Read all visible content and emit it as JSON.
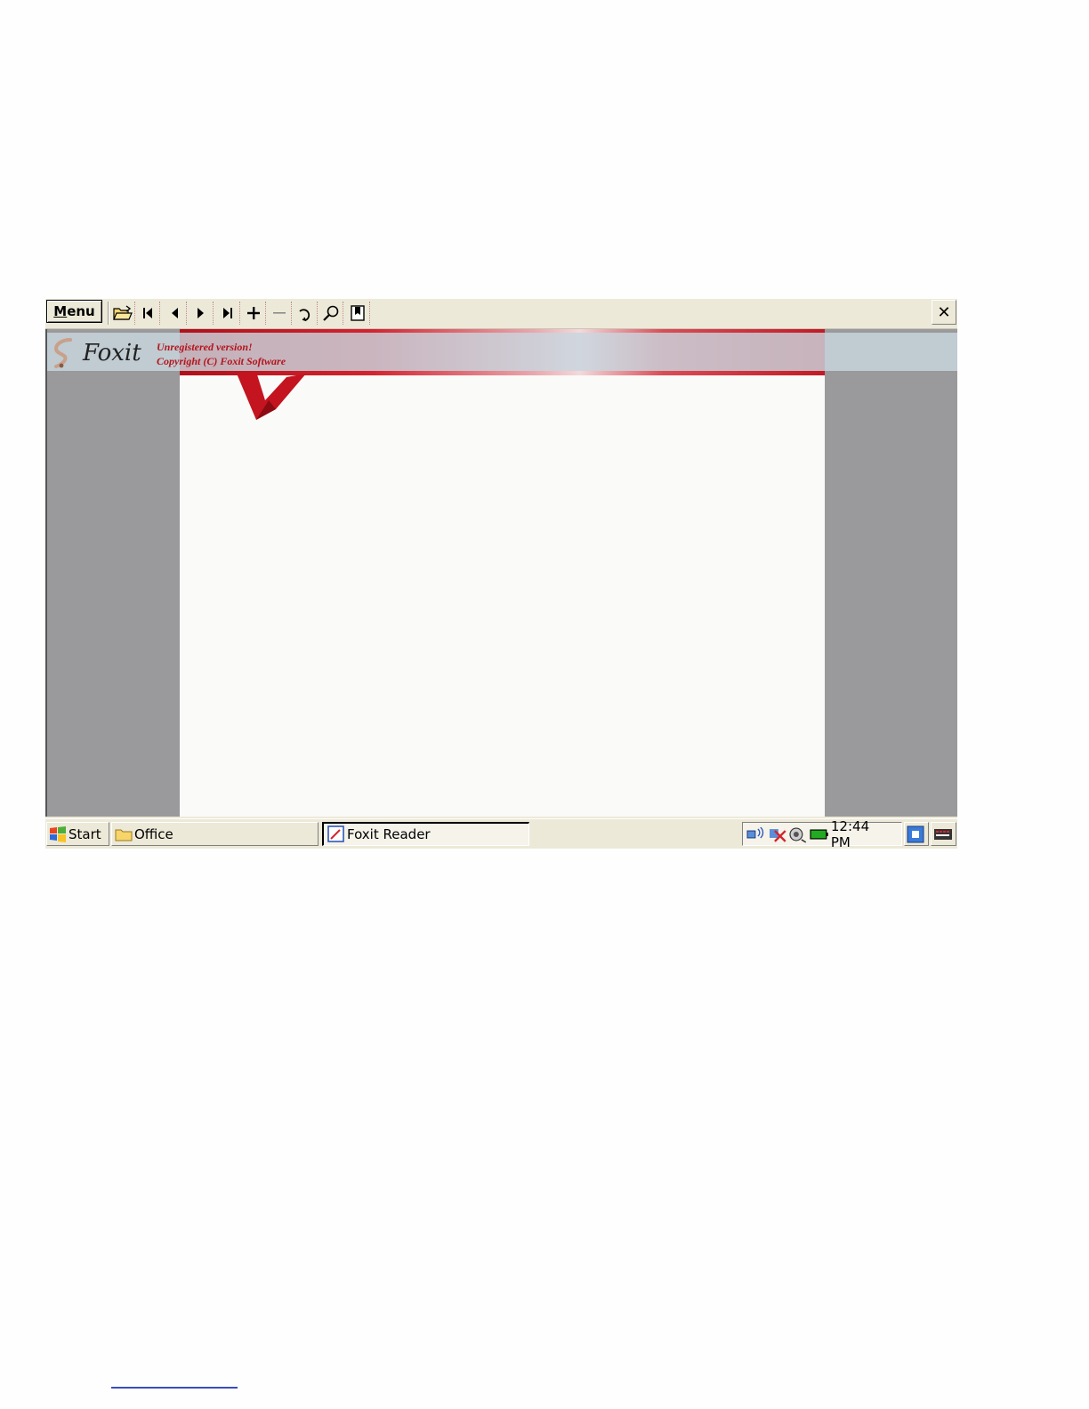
{
  "toolbar": {
    "menu_label_underlined": "M",
    "menu_label_rest": "enu",
    "buttons": [
      "open-icon",
      "first-page-icon",
      "previous-page-icon",
      "next-page-icon",
      "last-page-icon",
      "zoom-in-icon",
      "zoom-out-icon",
      "rotate-icon",
      "find-icon",
      "bookmark-icon"
    ],
    "close_glyph": "✕"
  },
  "banner": {
    "app_name": "Foxit",
    "line1": "Unregistered version!",
    "line2": "Copyright (C) Foxit Software"
  },
  "taskbar": {
    "start_label": "Start",
    "office_label": "Office",
    "active_task_label": "Foxit Reader",
    "clock": "12:44 PM"
  },
  "colors": {
    "accent_red": "#b4141c",
    "viewer_gray": "#9a999c",
    "chrome": "#ece9d8"
  }
}
